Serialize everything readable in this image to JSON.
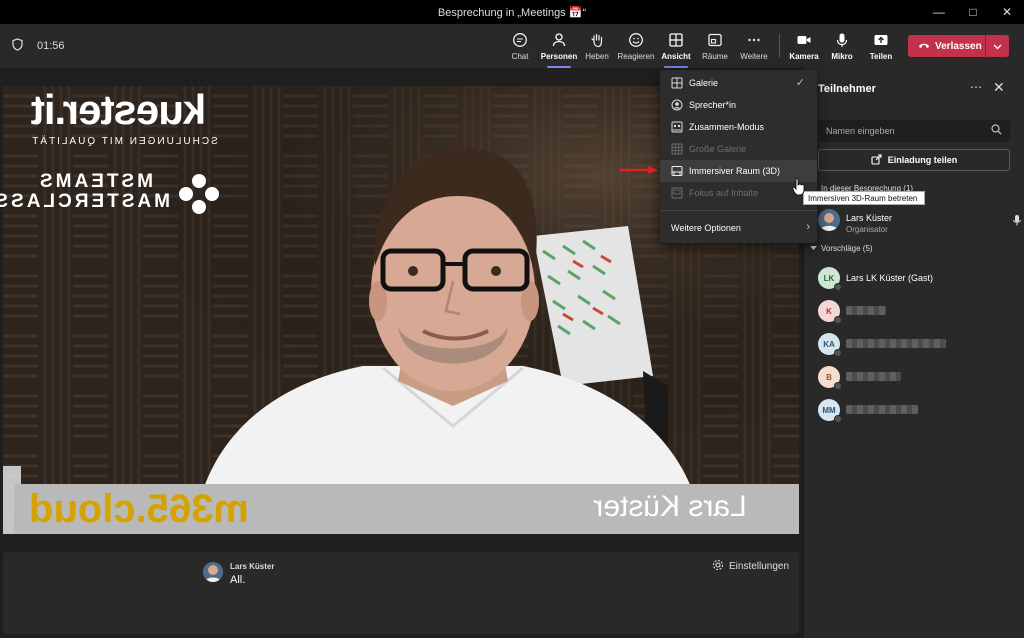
{
  "window": {
    "title": "Besprechung in „Meetings 📅“"
  },
  "toolbar": {
    "timer": "01:56",
    "items": [
      {
        "label": "Chat",
        "icon": "chat-icon"
      },
      {
        "label": "Personen",
        "icon": "people-icon"
      },
      {
        "label": "Heben",
        "icon": "raise-hand-icon"
      },
      {
        "label": "Reagieren",
        "icon": "react-icon"
      },
      {
        "label": "Ansicht",
        "icon": "view-icon"
      },
      {
        "label": "Räume",
        "icon": "rooms-icon"
      },
      {
        "label": "Weitere",
        "icon": "more-icon"
      },
      {
        "label": "Kamera",
        "icon": "camera-icon"
      },
      {
        "label": "Mikro",
        "icon": "mic-icon"
      },
      {
        "label": "Teilen",
        "icon": "share-icon"
      }
    ],
    "leave_label": "Verlassen"
  },
  "view_menu": {
    "items": [
      {
        "label": "Galerie",
        "state": "checked"
      },
      {
        "label": "Sprecher*in",
        "state": "normal"
      },
      {
        "label": "Zusammen-Modus",
        "state": "normal"
      },
      {
        "label": "Große Galerie",
        "state": "disabled"
      },
      {
        "label": "Immersiver Raum (3D)",
        "state": "hover"
      },
      {
        "label": "Fokus auf Inhalte",
        "state": "disabled"
      },
      {
        "label": "Weitere Optionen",
        "state": "submenu"
      }
    ],
    "tooltip": "Immersiven 3D-Raum betreten"
  },
  "video": {
    "brand_logo_text": "kuester.it",
    "brand_logo_sub": "SCHULUNGEN MIT QUALITÄT",
    "msteams_text": "MSTEAMS MASTERCLASS",
    "nameplate_logo": "m365.cloud",
    "nameplate_name": "Lars Küster"
  },
  "caption": {
    "speaker": "Lars Küster",
    "text": "All.",
    "settings_label": "Einstellungen"
  },
  "participants": {
    "title": "Teilnehmer",
    "search_placeholder": "Namen eingeben",
    "invite_label": "Einladung teilen",
    "in_meeting_label": "In dieser Besprechung (1)",
    "in_meeting": [
      {
        "name": "Lars Küster",
        "role": "Organisator"
      }
    ],
    "suggestions_label": "Vorschläge (5)",
    "suggestions": [
      {
        "initials": "LK",
        "name": "Lars LK Küster (Gast)",
        "color": "#cfe6d0",
        "text_color": "#2f6b33"
      },
      {
        "initials": "K",
        "name": "",
        "color": "#f5d6d6",
        "text_color": "#a33",
        "blur_width": 40
      },
      {
        "initials": "KA",
        "name": "",
        "color": "#d6e4ee",
        "text_color": "#2d5574",
        "blur_width": 100
      },
      {
        "initials": "B",
        "name": "",
        "color": "#f6dccf",
        "text_color": "#a0522d",
        "blur_width": 55
      },
      {
        "initials": "MM",
        "name": "",
        "color": "#d9e6ef",
        "text_color": "#2d5574",
        "blur_width": 72
      }
    ]
  }
}
